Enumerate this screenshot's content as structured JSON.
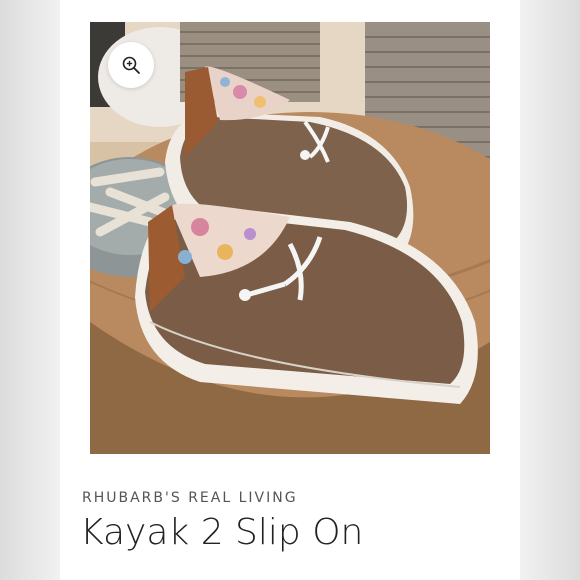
{
  "product": {
    "brand": "RHUBARB'S REAL LIVING",
    "title": "Kayak 2 Slip On",
    "image_alt": "Brown slip-on shoes with white soles and floral lining on a wooden table",
    "zoom_icon": "zoom-in-icon"
  },
  "colors": {
    "page_background": "#e9e9e9",
    "card_background": "#ffffff",
    "shoe_upper": "#7a5c46",
    "sole": "#f1ede6",
    "table_wood": "#b98a5f"
  }
}
